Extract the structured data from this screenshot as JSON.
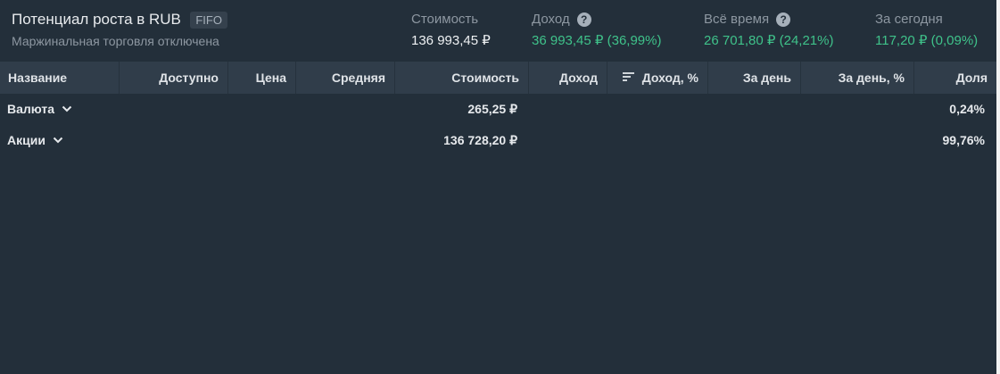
{
  "header": {
    "title": "Потенциал роста в RUB",
    "badge": "FIFO",
    "subtitle": "Маржинальная торговля отключена",
    "metrics": [
      {
        "label": "Стоимость",
        "value": "136 993,45 ₽",
        "help": false
      },
      {
        "label": "Доход",
        "value": "36 993,45 ₽ (36,99%)",
        "help": true
      },
      {
        "label": "Всё время",
        "value": "26 701,80 ₽ (24,21%)",
        "help": true
      },
      {
        "label": "За сегодня",
        "value": "117,20 ₽ (0,09%)",
        "help": false
      }
    ]
  },
  "table": {
    "columns": [
      "Название",
      "Доступно",
      "Цена",
      "Средняя",
      "Стоимость",
      "Доход",
      "Доход, %",
      "За день",
      "За день, %",
      "Доля"
    ],
    "rows": [
      {
        "name": "Валюта",
        "value": "265,25 ₽",
        "share": "0,24%"
      },
      {
        "name": "Акции",
        "value": "136 728,20 ₽",
        "share": "99,76%"
      }
    ]
  },
  "colors": {
    "background": "#232f3a",
    "header_row": "#303d4a",
    "positive": "#3fc28a",
    "muted": "#8d97a1"
  },
  "icons": [
    "help-icon",
    "sort-icon",
    "chevron-down-icon"
  ]
}
